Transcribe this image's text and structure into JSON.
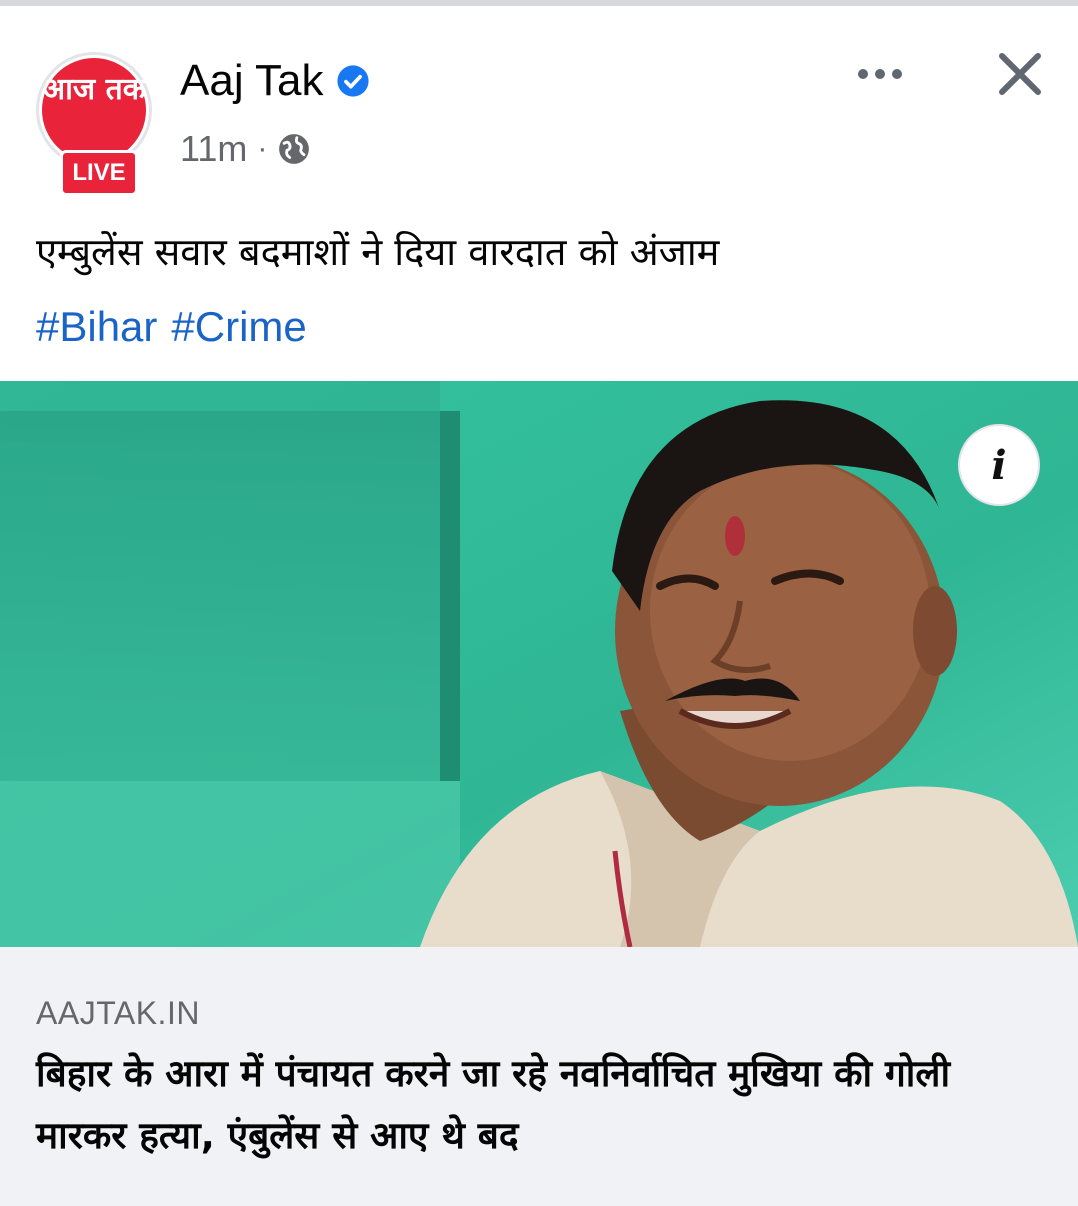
{
  "header": {
    "page_name": "Aaj Tak",
    "avatar_text": "आज तक",
    "live_badge": "LIVE",
    "timestamp": "11m",
    "separator": "·",
    "verified_icon": "verified-badge-icon",
    "privacy_icon": "globe-icon"
  },
  "post": {
    "text": "एम्बुलेंस सवार बदमाशों ने दिया वारदात को अंजाम",
    "hashtags": [
      "#Bihar",
      "#Crime"
    ]
  },
  "link_preview": {
    "domain": "AAJTAK.IN",
    "title": "बिहार के आरा में पंचायत करने जा रहे नवनिर्वाचित मुखिया की गोली मारकर हत्या, एंबुलेंस से आए थे बद",
    "info_label": "i"
  },
  "colors": {
    "brand_red": "#e8233a",
    "link_blue": "#1b64c7",
    "verified_blue": "#1877f2",
    "photo_wall": "#3fbf9d",
    "preview_bg": "#f0f2f5"
  }
}
